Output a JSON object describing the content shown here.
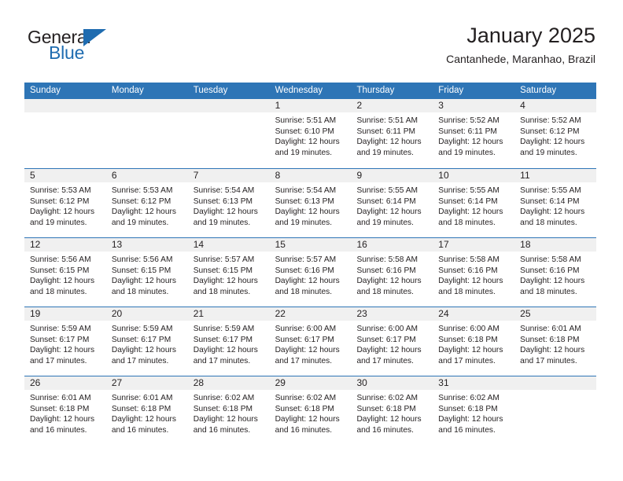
{
  "brand": {
    "name_top": "General",
    "name_bottom": "Blue",
    "accent_color": "#1f6cb0"
  },
  "header": {
    "title": "January 2025",
    "subtitle": "Cantanhede, Maranhao, Brazil"
  },
  "calendar": {
    "header_bg": "#2e75b6",
    "day_band_bg": "#f0f0f0",
    "weekdays": [
      "Sunday",
      "Monday",
      "Tuesday",
      "Wednesday",
      "Thursday",
      "Friday",
      "Saturday"
    ],
    "weeks": [
      [
        {
          "day": "",
          "sunrise": "",
          "sunset": "",
          "daylight1": "",
          "daylight2": ""
        },
        {
          "day": "",
          "sunrise": "",
          "sunset": "",
          "daylight1": "",
          "daylight2": ""
        },
        {
          "day": "",
          "sunrise": "",
          "sunset": "",
          "daylight1": "",
          "daylight2": ""
        },
        {
          "day": "1",
          "sunrise": "Sunrise: 5:51 AM",
          "sunset": "Sunset: 6:10 PM",
          "daylight1": "Daylight: 12 hours",
          "daylight2": "and 19 minutes."
        },
        {
          "day": "2",
          "sunrise": "Sunrise: 5:51 AM",
          "sunset": "Sunset: 6:11 PM",
          "daylight1": "Daylight: 12 hours",
          "daylight2": "and 19 minutes."
        },
        {
          "day": "3",
          "sunrise": "Sunrise: 5:52 AM",
          "sunset": "Sunset: 6:11 PM",
          "daylight1": "Daylight: 12 hours",
          "daylight2": "and 19 minutes."
        },
        {
          "day": "4",
          "sunrise": "Sunrise: 5:52 AM",
          "sunset": "Sunset: 6:12 PM",
          "daylight1": "Daylight: 12 hours",
          "daylight2": "and 19 minutes."
        }
      ],
      [
        {
          "day": "5",
          "sunrise": "Sunrise: 5:53 AM",
          "sunset": "Sunset: 6:12 PM",
          "daylight1": "Daylight: 12 hours",
          "daylight2": "and 19 minutes."
        },
        {
          "day": "6",
          "sunrise": "Sunrise: 5:53 AM",
          "sunset": "Sunset: 6:12 PM",
          "daylight1": "Daylight: 12 hours",
          "daylight2": "and 19 minutes."
        },
        {
          "day": "7",
          "sunrise": "Sunrise: 5:54 AM",
          "sunset": "Sunset: 6:13 PM",
          "daylight1": "Daylight: 12 hours",
          "daylight2": "and 19 minutes."
        },
        {
          "day": "8",
          "sunrise": "Sunrise: 5:54 AM",
          "sunset": "Sunset: 6:13 PM",
          "daylight1": "Daylight: 12 hours",
          "daylight2": "and 19 minutes."
        },
        {
          "day": "9",
          "sunrise": "Sunrise: 5:55 AM",
          "sunset": "Sunset: 6:14 PM",
          "daylight1": "Daylight: 12 hours",
          "daylight2": "and 19 minutes."
        },
        {
          "day": "10",
          "sunrise": "Sunrise: 5:55 AM",
          "sunset": "Sunset: 6:14 PM",
          "daylight1": "Daylight: 12 hours",
          "daylight2": "and 18 minutes."
        },
        {
          "day": "11",
          "sunrise": "Sunrise: 5:55 AM",
          "sunset": "Sunset: 6:14 PM",
          "daylight1": "Daylight: 12 hours",
          "daylight2": "and 18 minutes."
        }
      ],
      [
        {
          "day": "12",
          "sunrise": "Sunrise: 5:56 AM",
          "sunset": "Sunset: 6:15 PM",
          "daylight1": "Daylight: 12 hours",
          "daylight2": "and 18 minutes."
        },
        {
          "day": "13",
          "sunrise": "Sunrise: 5:56 AM",
          "sunset": "Sunset: 6:15 PM",
          "daylight1": "Daylight: 12 hours",
          "daylight2": "and 18 minutes."
        },
        {
          "day": "14",
          "sunrise": "Sunrise: 5:57 AM",
          "sunset": "Sunset: 6:15 PM",
          "daylight1": "Daylight: 12 hours",
          "daylight2": "and 18 minutes."
        },
        {
          "day": "15",
          "sunrise": "Sunrise: 5:57 AM",
          "sunset": "Sunset: 6:16 PM",
          "daylight1": "Daylight: 12 hours",
          "daylight2": "and 18 minutes."
        },
        {
          "day": "16",
          "sunrise": "Sunrise: 5:58 AM",
          "sunset": "Sunset: 6:16 PM",
          "daylight1": "Daylight: 12 hours",
          "daylight2": "and 18 minutes."
        },
        {
          "day": "17",
          "sunrise": "Sunrise: 5:58 AM",
          "sunset": "Sunset: 6:16 PM",
          "daylight1": "Daylight: 12 hours",
          "daylight2": "and 18 minutes."
        },
        {
          "day": "18",
          "sunrise": "Sunrise: 5:58 AM",
          "sunset": "Sunset: 6:16 PM",
          "daylight1": "Daylight: 12 hours",
          "daylight2": "and 18 minutes."
        }
      ],
      [
        {
          "day": "19",
          "sunrise": "Sunrise: 5:59 AM",
          "sunset": "Sunset: 6:17 PM",
          "daylight1": "Daylight: 12 hours",
          "daylight2": "and 17 minutes."
        },
        {
          "day": "20",
          "sunrise": "Sunrise: 5:59 AM",
          "sunset": "Sunset: 6:17 PM",
          "daylight1": "Daylight: 12 hours",
          "daylight2": "and 17 minutes."
        },
        {
          "day": "21",
          "sunrise": "Sunrise: 5:59 AM",
          "sunset": "Sunset: 6:17 PM",
          "daylight1": "Daylight: 12 hours",
          "daylight2": "and 17 minutes."
        },
        {
          "day": "22",
          "sunrise": "Sunrise: 6:00 AM",
          "sunset": "Sunset: 6:17 PM",
          "daylight1": "Daylight: 12 hours",
          "daylight2": "and 17 minutes."
        },
        {
          "day": "23",
          "sunrise": "Sunrise: 6:00 AM",
          "sunset": "Sunset: 6:17 PM",
          "daylight1": "Daylight: 12 hours",
          "daylight2": "and 17 minutes."
        },
        {
          "day": "24",
          "sunrise": "Sunrise: 6:00 AM",
          "sunset": "Sunset: 6:18 PM",
          "daylight1": "Daylight: 12 hours",
          "daylight2": "and 17 minutes."
        },
        {
          "day": "25",
          "sunrise": "Sunrise: 6:01 AM",
          "sunset": "Sunset: 6:18 PM",
          "daylight1": "Daylight: 12 hours",
          "daylight2": "and 17 minutes."
        }
      ],
      [
        {
          "day": "26",
          "sunrise": "Sunrise: 6:01 AM",
          "sunset": "Sunset: 6:18 PM",
          "daylight1": "Daylight: 12 hours",
          "daylight2": "and 16 minutes."
        },
        {
          "day": "27",
          "sunrise": "Sunrise: 6:01 AM",
          "sunset": "Sunset: 6:18 PM",
          "daylight1": "Daylight: 12 hours",
          "daylight2": "and 16 minutes."
        },
        {
          "day": "28",
          "sunrise": "Sunrise: 6:02 AM",
          "sunset": "Sunset: 6:18 PM",
          "daylight1": "Daylight: 12 hours",
          "daylight2": "and 16 minutes."
        },
        {
          "day": "29",
          "sunrise": "Sunrise: 6:02 AM",
          "sunset": "Sunset: 6:18 PM",
          "daylight1": "Daylight: 12 hours",
          "daylight2": "and 16 minutes."
        },
        {
          "day": "30",
          "sunrise": "Sunrise: 6:02 AM",
          "sunset": "Sunset: 6:18 PM",
          "daylight1": "Daylight: 12 hours",
          "daylight2": "and 16 minutes."
        },
        {
          "day": "31",
          "sunrise": "Sunrise: 6:02 AM",
          "sunset": "Sunset: 6:18 PM",
          "daylight1": "Daylight: 12 hours",
          "daylight2": "and 16 minutes."
        },
        {
          "day": "",
          "sunrise": "",
          "sunset": "",
          "daylight1": "",
          "daylight2": ""
        }
      ]
    ]
  }
}
